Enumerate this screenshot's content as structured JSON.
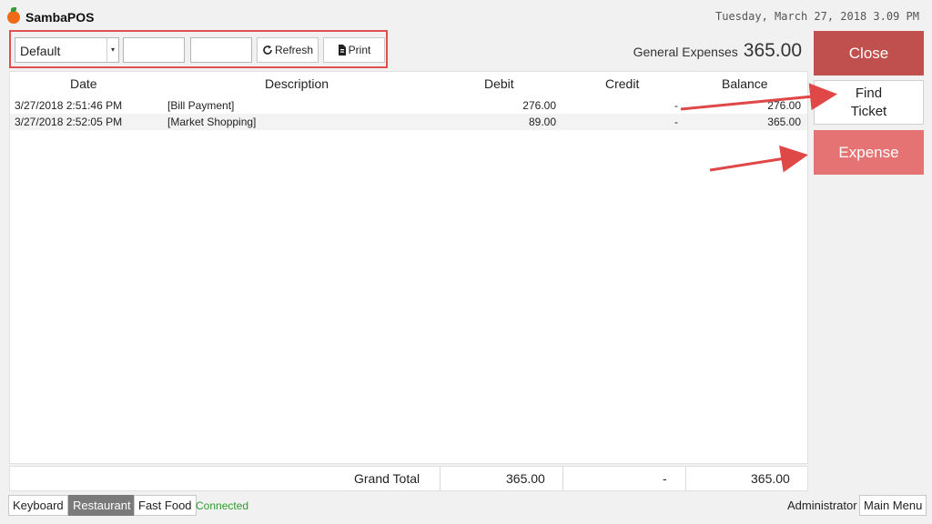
{
  "app": {
    "name": "SambaPOS",
    "datetime": "Tuesday, March 27, 2018 3.09 PM"
  },
  "toolbar": {
    "filter_value": "Default",
    "refresh_label": "Refresh",
    "print_label": "Print"
  },
  "account": {
    "name": "General Expenses",
    "balance": "365.00"
  },
  "table": {
    "columns": [
      "Date",
      "Description",
      "Debit",
      "Credit",
      "Balance"
    ],
    "rows": [
      {
        "date": "3/27/2018 2:51:46 PM",
        "description": "[Bill Payment]",
        "debit": "276.00",
        "credit": "-",
        "balance": "276.00"
      },
      {
        "date": "3/27/2018 2:52:05 PM",
        "description": "[Market Shopping]",
        "debit": "89.00",
        "credit": "-",
        "balance": "365.00"
      }
    ],
    "totals": {
      "label": "Grand Total",
      "debit": "365.00",
      "credit": "-",
      "balance": "365.00"
    }
  },
  "actions": {
    "close_label": "Close",
    "find_ticket_line1": "Find",
    "find_ticket_line2": "Ticket",
    "expense_label": "Expense"
  },
  "bottom_bar": {
    "keyboard": "Keyboard",
    "restaurant": "Restaurant",
    "fast_food": "Fast Food",
    "status": "Connected",
    "user": "Administrator",
    "main_menu": "Main Menu"
  },
  "colors": {
    "close_button": "#c0504d",
    "expense_button": "#e57373",
    "highlight_box": "#e05050",
    "status_ok": "#2f9a2f"
  }
}
